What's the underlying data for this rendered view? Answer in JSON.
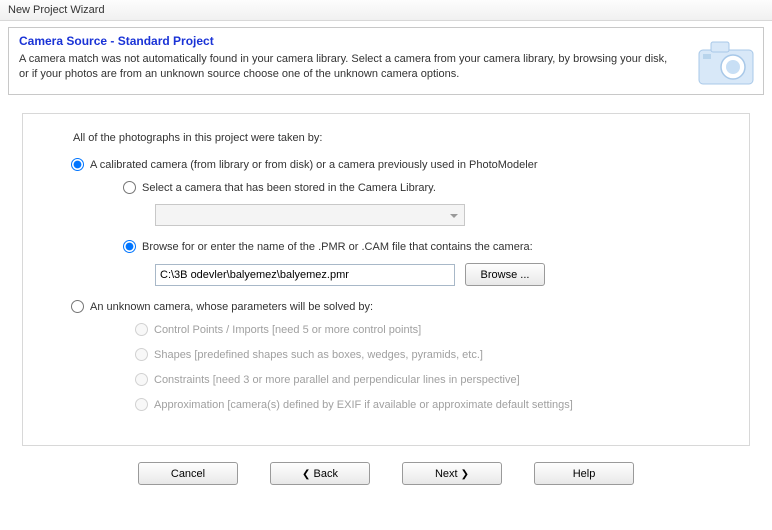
{
  "window": {
    "title": "New Project Wizard"
  },
  "header": {
    "title": "Camera Source - Standard Project",
    "description": "A camera match was not automatically found in your camera library. Select a camera from your camera library, by browsing your disk, or if your photos are from an unknown source choose one of the unknown camera options."
  },
  "content": {
    "intro": "All of the photographs in this project were taken by:",
    "optCalibrated": "A calibrated camera (from library or from disk) or a camera previously used in PhotoModeler",
    "optLibrary": "Select a camera that has been stored in the Camera Library.",
    "optBrowse": "Browse for or enter the name of the .PMR or .CAM file that contains the camera:",
    "path": "C:\\3B odevler\\balyemez\\balyemez.pmr",
    "browseBtn": "Browse ...",
    "optUnknown": "An unknown camera, whose parameters will be solved by:",
    "subControl": "Control Points / Imports [need 5 or more control points]",
    "subShapes": "Shapes [predefined shapes such as boxes, wedges, pyramids, etc.]",
    "subConstraints": "Constraints [need 3 or more parallel and perpendicular lines in perspective]",
    "subApprox": "Approximation [camera(s) defined by EXIF if available or approximate default settings]"
  },
  "footer": {
    "cancel": "Cancel",
    "back": "Back",
    "next": "Next",
    "help": "Help"
  }
}
